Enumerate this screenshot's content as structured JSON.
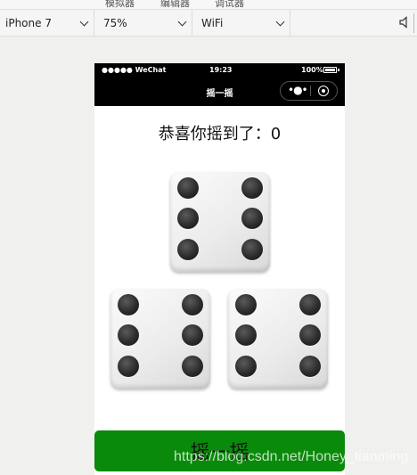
{
  "devtools": {
    "top_labels": [
      "模拟器",
      "编辑器",
      "调试器"
    ],
    "device": "iPhone 7",
    "zoom": "75%",
    "network": "WiFi"
  },
  "statusbar": {
    "signal": "●●●●● WeChat",
    "time": "19:23",
    "battery": "100%"
  },
  "navbar": {
    "title": "摇一摇"
  },
  "result_text": "恭喜你摇到了：0",
  "dice": [
    {
      "value": 6
    },
    {
      "value": 6
    },
    {
      "value": 6
    }
  ],
  "shake_button": "摇一摇",
  "watermark": "https://blog.csdn.net/Honey_tianming"
}
